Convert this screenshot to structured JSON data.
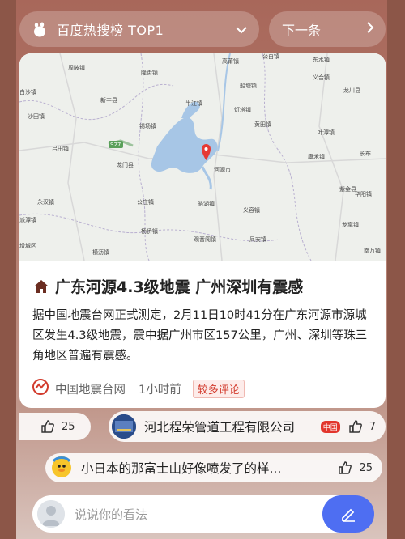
{
  "top_bar": {
    "title": "百度热搜榜 TOP1",
    "next_label": "下一条"
  },
  "news": {
    "headline": "广东河源4.3级地震 广州深圳有震感",
    "body": "据中国地震台网正式测定，2月11日10时41分在广东河源市源城区发生4.3级地震，震中据广州市区157公里，广州、深圳等珠三角地区普遍有震感。",
    "source": "中国地震台网",
    "time": "1小时前",
    "badge": "较多评论"
  },
  "map": {
    "labels": [
      "公白镇",
      "东水镇",
      "高莆镇",
      "龙川县",
      "周陂镇",
      "隆街镇",
      "船塘镇",
      "义合镇",
      "新丰县",
      "半江镇",
      "灯塔镇",
      "叶潭镇",
      "白沙镇",
      "沙田镇",
      "锡场镇",
      "黄田镇",
      "合镇",
      "吕田镇",
      "康禾镇",
      "长布",
      "龙门县",
      "河源市",
      "紫金县",
      "永汉镇",
      "公庄镇",
      "骆湖镇",
      "义容镇",
      "华阳镇",
      "派潭镇",
      "杨侨镇",
      "观音阁镇",
      "凤安镇",
      "龙窝镇",
      "增城区",
      "横沥镇",
      "南万镇",
      "S27"
    ],
    "road_label": "S27",
    "marker_icon": "location-pin-icon"
  },
  "comments": [
    {
      "likes": "25"
    },
    {
      "author": "河北程荣管道工程有限公司",
      "tag": "中国",
      "likes": "7"
    },
    {
      "text": "小日本的那富士山好像喷发了的样...",
      "likes": "25"
    }
  ],
  "input": {
    "placeholder": "说说你的看法"
  },
  "colors": {
    "accent": "#4e6ef2",
    "badge_red": "#d23b2d",
    "background": "#b27a6c"
  }
}
